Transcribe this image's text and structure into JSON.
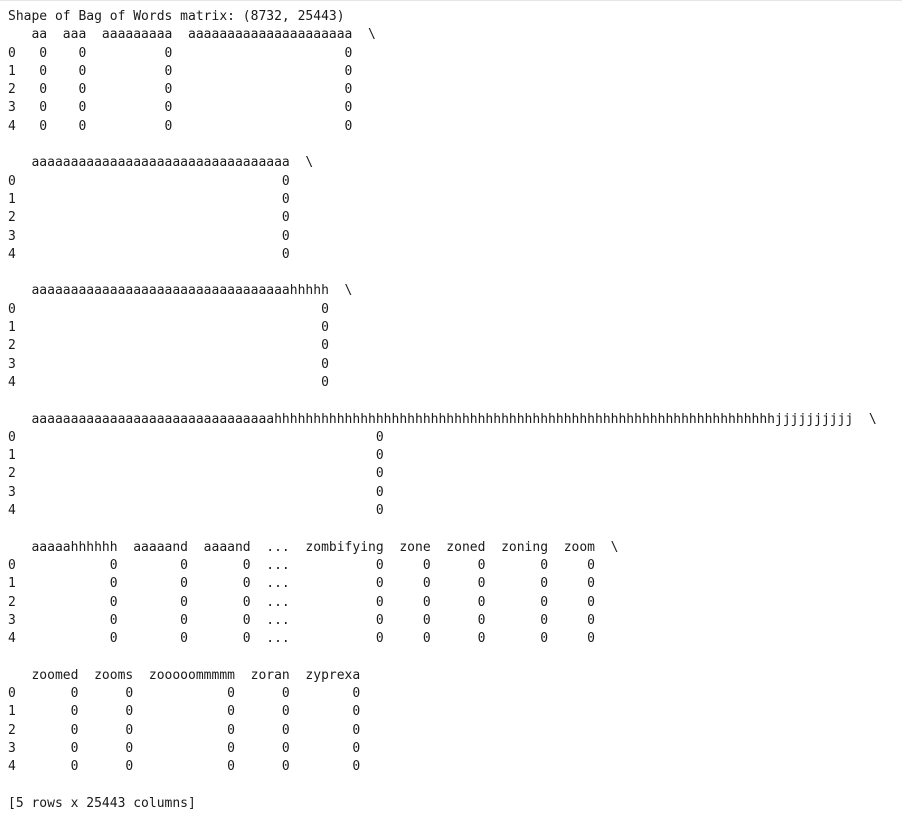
{
  "output": {
    "lines": [
      "Shape of Bag of Words matrix: (8732, 25443)",
      "   aa  aaa  aaaaaaaaa  aaaaaaaaaaaaaaaaaaaaa  \\",
      "0   0    0          0                      0   ",
      "1   0    0          0                      0   ",
      "2   0    0          0                      0   ",
      "3   0    0          0                      0   ",
      "4   0    0          0                      0   ",
      "",
      "   aaaaaaaaaaaaaaaaaaaaaaaaaaaaaaaaa  \\",
      "0                                  0   ",
      "1                                  0   ",
      "2                                  0   ",
      "3                                  0   ",
      "4                                  0   ",
      "",
      "   aaaaaaaaaaaaaaaaaaaaaaaaaaaaaaaaahhhhh  \\",
      "0                                       0   ",
      "1                                       0   ",
      "2                                       0   ",
      "3                                       0   ",
      "4                                       0   ",
      "",
      "   aaaaaaaaaaaaaaaaaaaaaaaaaaaaaaahhhhhhhhhhhhhhhhhhhhhhhhhhhhhhhhhhhhhhhhhhhhhhhhhhhhhhhhhhhhhhhhjjjjjjjjjj  \\",
      "0                                              0   ",
      "1                                              0   ",
      "2                                              0   ",
      "3                                              0   ",
      "4                                              0   ",
      "",
      "   aaaaahhhhhh  aaaaand  aaaand  ...  zombifying  zone  zoned  zoning  zoom  \\",
      "0            0        0       0  ...           0     0      0       0     0   ",
      "1            0        0       0  ...           0     0      0       0     0   ",
      "2            0        0       0  ...           0     0      0       0     0   ",
      "3            0        0       0  ...           0     0      0       0     0   ",
      "4            0        0       0  ...           0     0      0       0     0   ",
      "",
      "   zoomed  zooms  zooooommmmm  zoran  zyprexa  ",
      "0       0      0            0      0        0  ",
      "1       0      0            0      0        0  ",
      "2       0      0            0      0        0  ",
      "3       0      0            0      0        0  ",
      "4       0      0            0      0        0  ",
      "",
      "[5 rows x 25443 columns]"
    ]
  }
}
